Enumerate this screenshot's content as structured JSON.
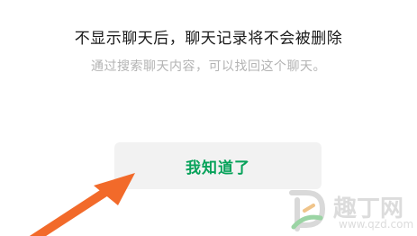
{
  "dialog": {
    "title": "不显示聊天后，聊天记录将不会被删除",
    "subtitle": "通过搜索聊天内容，可以找回这个聊天。",
    "confirm_label": "我知道了"
  },
  "watermark": {
    "name": "趣丁网",
    "url": "www.qzd.com"
  },
  "colors": {
    "accent": "#07a25a",
    "arrow": "#f26a2a",
    "button_bg": "#f2f2f2"
  }
}
